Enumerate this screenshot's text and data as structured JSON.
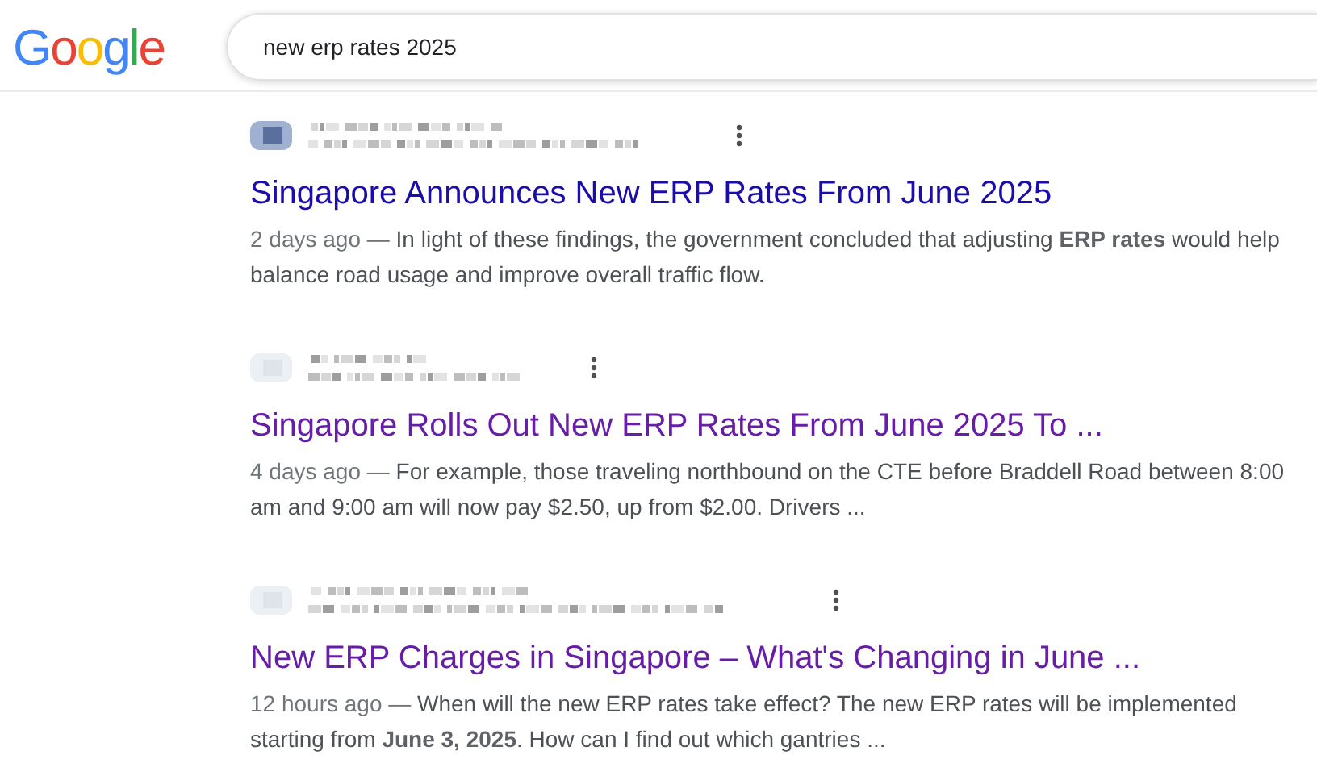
{
  "logo": {
    "letters": [
      {
        "char": "G",
        "color": "#4285f4"
      },
      {
        "char": "o",
        "color": "#ea4335"
      },
      {
        "char": "o",
        "color": "#fbbc05"
      },
      {
        "char": "g",
        "color": "#4285f4"
      },
      {
        "char": "l",
        "color": "#34a853"
      },
      {
        "char": "e",
        "color": "#ea4335"
      }
    ]
  },
  "search": {
    "value": "new erp rates 2025"
  },
  "results": [
    {
      "title": "Singapore Announces New ERP Rates From June 2025",
      "visited": false,
      "date": "2 days ago —",
      "snippet": "In light of these findings, the government concluded that adjusting **ERP rates** would help balance road usage and improve overall traffic flow."
    },
    {
      "title": "Singapore Rolls Out New ERP Rates From June 2025 To ...",
      "visited": true,
      "date": "4 days ago —",
      "snippet": "For example, those traveling northbound on the CTE before Braddell Road between 8:00 am and 9:00 am will now pay $2.50, up from $2.00. Drivers ..."
    },
    {
      "title": "New ERP Charges in Singapore – What's Changing in June ...",
      "visited": true,
      "date": "12 hours ago —",
      "snippet": "When will the new ERP rates take effect? The new ERP rates will be implemented starting from **June 3, 2025**. How can I find out which gantries ..."
    }
  ]
}
